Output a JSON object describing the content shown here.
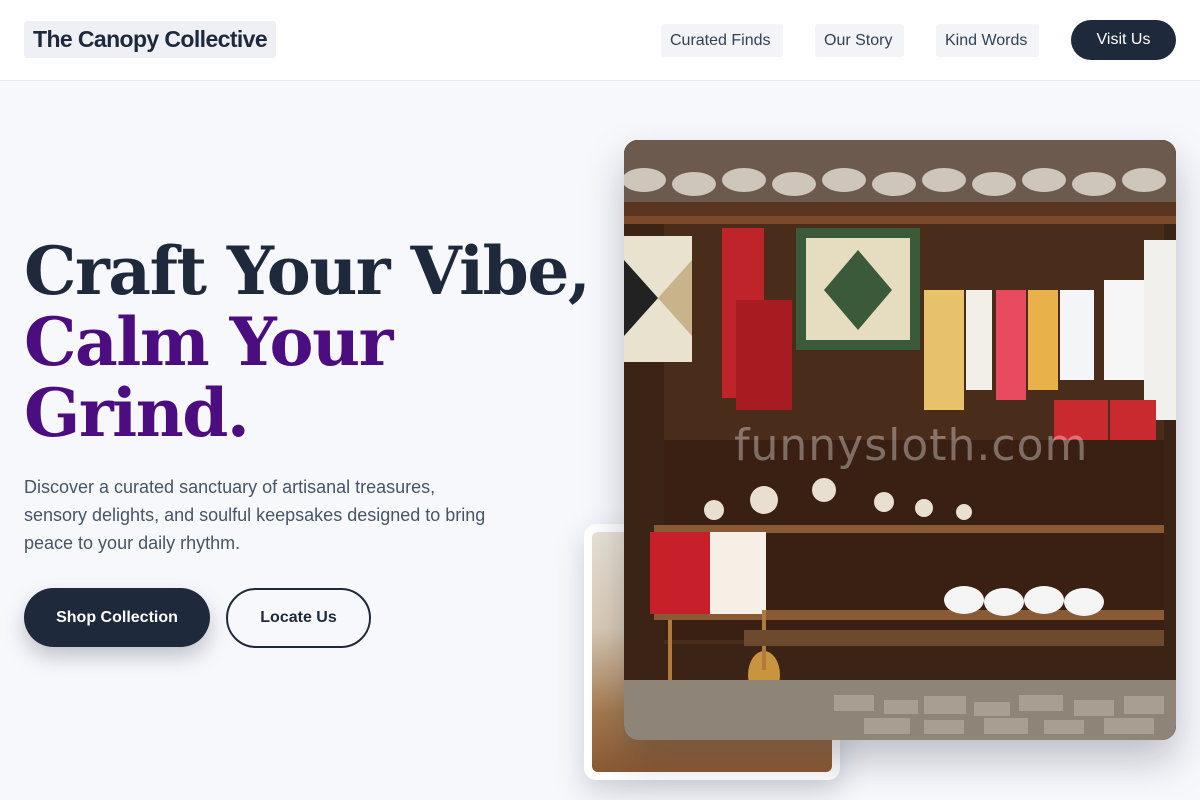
{
  "header": {
    "logo": "The Canopy Collective",
    "nav": [
      "Curated Finds",
      "Our Story",
      "Kind Words"
    ],
    "cta": "Visit Us"
  },
  "hero": {
    "title_line1": "Craft Your Vibe,",
    "title_line2": "Calm Your",
    "title_line3": "Grind.",
    "description": "Discover a curated sanctuary of artisanal treasures, sensory delights, and soulful keepsakes designed to bring peace to your daily rhythm.",
    "primary_button": "Shop Collection",
    "secondary_button": "Locate Us"
  },
  "images": {
    "main_watermark": "funnysloth.com"
  },
  "colors": {
    "navy": "#1e293b",
    "purple": "#4c0d80",
    "background": "#f7f8fc"
  }
}
